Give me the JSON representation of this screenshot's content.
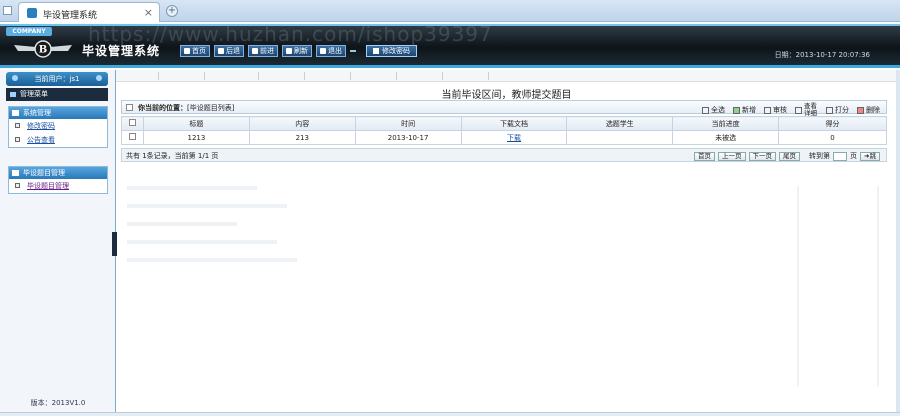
{
  "browser": {
    "tab_title": "毕设管理系统",
    "tab_close": "×",
    "new_tab": "+"
  },
  "header": {
    "company": "COMPANY",
    "system_name": "毕设管理系统",
    "nav": [
      {
        "label": "首页",
        "icon": "home-icon"
      },
      {
        "label": "后退",
        "icon": "back-icon"
      },
      {
        "label": "前进",
        "icon": "forward-icon"
      },
      {
        "label": "刷新",
        "icon": "refresh-icon"
      },
      {
        "label": "退出",
        "icon": "power-icon"
      }
    ],
    "modify_password": "修改密码",
    "datetime": "日期：2013-10-17 20:07:36"
  },
  "sidebar": {
    "current_user": "当前用户：js1",
    "menu_title": "管理菜单",
    "groups": [
      {
        "title": "系统管理",
        "items": [
          "修改密码",
          "公告查看"
        ]
      },
      {
        "title": "毕设题目管理",
        "items": [
          "毕设题目管理"
        ]
      }
    ],
    "version": "版本：2013V1.0"
  },
  "main": {
    "page_title": "当前毕设区间，教师提交题目",
    "breadcrumb_prefix": "你当前的位置：",
    "breadcrumb": "[毕设题目列表]",
    "tools": [
      "全选",
      "新增",
      "审核",
      "查看详细",
      "打分",
      "删除"
    ],
    "columns": [
      "",
      "标题",
      "内容",
      "时间",
      "下载文档",
      "选题学生",
      "当前进度",
      "得分"
    ],
    "rows": [
      [
        "",
        "1213",
        "213",
        "2013-10-17",
        "下载",
        "",
        "未被选",
        "0"
      ]
    ],
    "pager": {
      "info": "共有 1条记录，当前第 1/1 页",
      "buttons": [
        "首页",
        "上一页",
        "下一页",
        "尾页"
      ],
      "goto": "转到第",
      "page_unit": "页",
      "jump": "跳"
    }
  },
  "watermark": "https://www.huzhan.com/ishop39397"
}
